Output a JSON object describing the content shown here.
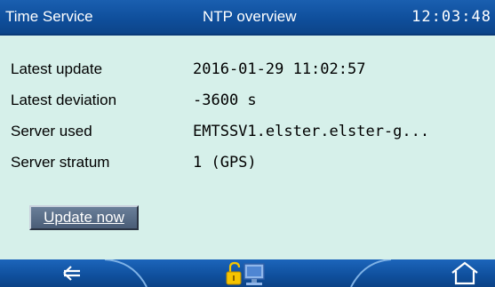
{
  "header": {
    "app_name": "Time Service",
    "title": "NTP overview",
    "clock": "12:03:48"
  },
  "rows": [
    {
      "label": "Latest update",
      "value": "2016-01-29 11:02:57"
    },
    {
      "label": "Latest deviation",
      "value": "-3600 s"
    },
    {
      "label": "Server used",
      "value": "EMTSSV1.elster.elster-g..."
    },
    {
      "label": "Server stratum",
      "value": "1 (GPS)"
    }
  ],
  "actions": {
    "update_now_label": "Update now"
  },
  "nav": {
    "back_icon": "left-arrow-icon",
    "lock_icon": "padlock-icon",
    "monitor_icon": "monitor-icon",
    "home_icon": "home-icon"
  },
  "colors": {
    "background": "#d6f0ea",
    "header": "#0f4f9c",
    "button": "#56698a"
  }
}
